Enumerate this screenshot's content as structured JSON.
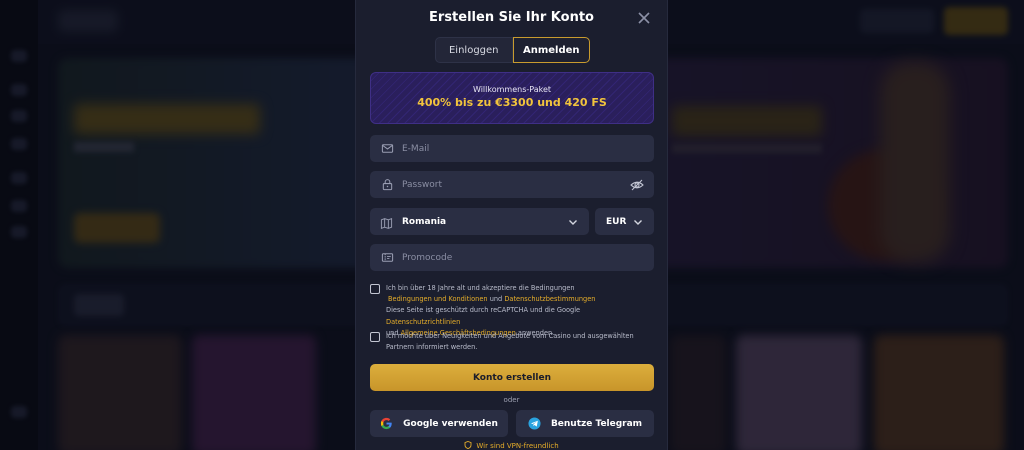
{
  "modal": {
    "title": "Erstellen Sie Ihr Konto",
    "tabs": [
      {
        "label": "Einloggen",
        "active": false
      },
      {
        "label": "Anmelden",
        "active": true
      }
    ],
    "promo": {
      "small": "Willkommens-Paket",
      "big": "400% bis zu €3300 und 420 FS"
    },
    "email_placeholder": "E-Mail",
    "password_placeholder": "Passwort",
    "country_value": "Romania",
    "currency_value": "EUR",
    "promocode_placeholder": "Promocode",
    "terms": {
      "text1": "Ich bin über 18 Jahre alt und akzeptiere die Bedingungen",
      "link1": "Bedingungen und Konditionen",
      "and1": "und",
      "link2": "Datenschutzbestimmungen",
      "text2": "Diese Seite ist geschützt durch reCAPTCHA und die Google",
      "link3": "Datenschutzrichtlinien",
      "and2": "und",
      "link4": "Allgemeine Geschäftsbedingungen",
      "text3": "anwenden."
    },
    "newsletter": "Ich möchte über Neuigkeiten und Angebote vom Casino und ausgewählten Partnern informiert werden.",
    "submit_label": "Konto erstellen",
    "divider_label": "oder",
    "google_label": "Google verwenden",
    "telegram_label": "Benutze Telegram",
    "vpn_label": "Wir sind VPN-freundlich"
  },
  "colors": {
    "accent": "#e5ad2a",
    "modal_bg": "#1b1e2e",
    "field_bg": "#2a2e43"
  }
}
